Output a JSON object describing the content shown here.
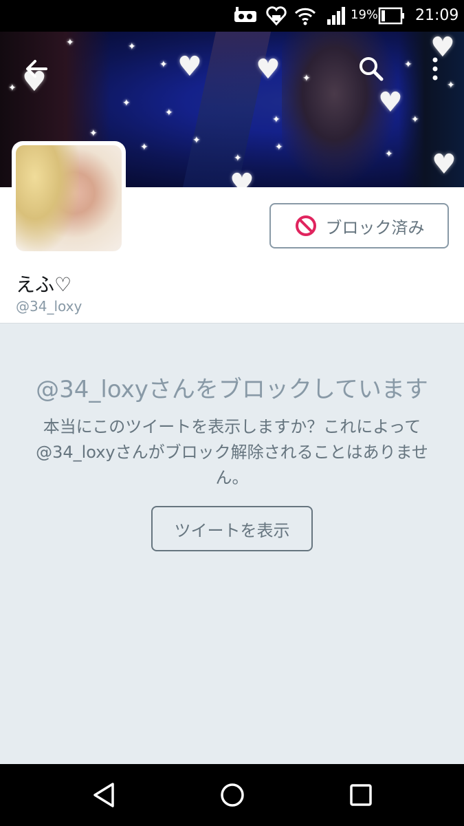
{
  "status_bar": {
    "battery_percent": "19%",
    "time": "21:09",
    "icons": [
      "vr-icon",
      "heart-app-icon",
      "wifi-icon",
      "signal-icon",
      "battery-icon"
    ]
  },
  "header": {
    "back_icon": "back-arrow-icon",
    "search_icon": "search-icon",
    "more_icon": "more-vert-icon"
  },
  "profile": {
    "display_name": "えふ♡",
    "handle": "@34_loxy",
    "blocked_button": {
      "label": "ブロック済み",
      "icon": "blocked-icon",
      "icon_color": "#e0245e"
    }
  },
  "blocked_notice": {
    "title": "@34_loxyさんをブロックしています",
    "body": "本当にこのツイートを表示しますか？これによって@34_loxyさんがブロック解除されることはありません。",
    "show_button_label": "ツイートを表示"
  },
  "nav_bar": {
    "icons": [
      "back-triangle-icon",
      "home-circle-icon",
      "recents-square-icon"
    ]
  },
  "colors": {
    "notice_background": "#e6ecf0",
    "secondary_text": "#8899a6",
    "body_text": "#66757f",
    "primary_text": "#14171a"
  }
}
